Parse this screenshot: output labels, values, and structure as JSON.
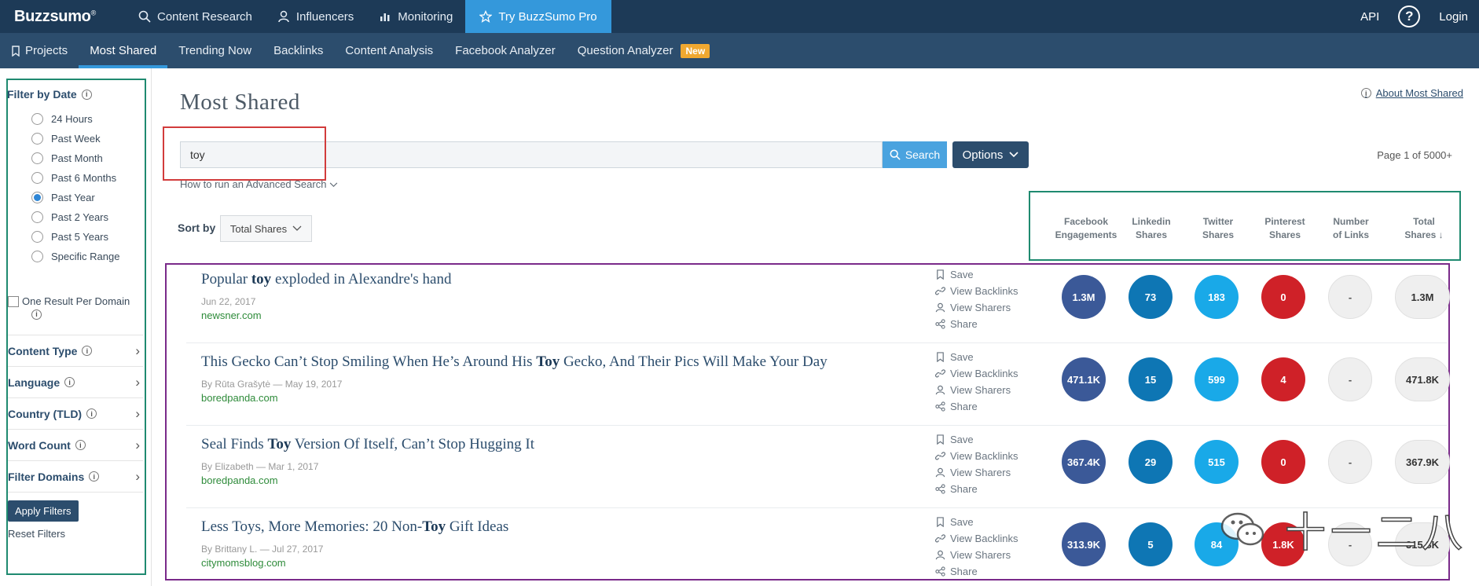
{
  "topbar": {
    "logo": "Buzzsumo",
    "nav": [
      {
        "label": "Content Research",
        "icon": "search-icon"
      },
      {
        "label": "Influencers",
        "icon": "user-icon"
      },
      {
        "label": "Monitoring",
        "icon": "bar-chart-icon"
      },
      {
        "label": "Try BuzzSumo Pro",
        "icon": "star-icon"
      }
    ],
    "api": "API",
    "help": "?",
    "login": "Login"
  },
  "subnav": {
    "items": [
      "Projects",
      "Most Shared",
      "Trending Now",
      "Backlinks",
      "Content Analysis",
      "Facebook Analyzer",
      "Question Analyzer"
    ],
    "active": "Most Shared",
    "new_badge": "New"
  },
  "sidebar": {
    "date_heading": "Filter by Date",
    "date_options": [
      "24 Hours",
      "Past Week",
      "Past Month",
      "Past 6 Months",
      "Past Year",
      "Past 2 Years",
      "Past 5 Years",
      "Specific Range"
    ],
    "selected_date": "Past Year",
    "one_result": "One Result Per Domain",
    "filters": [
      "Content Type",
      "Language",
      "Country (TLD)",
      "Word Count",
      "Filter Domains"
    ],
    "apply": "Apply Filters",
    "reset": "Reset Filters"
  },
  "main": {
    "title": "Most Shared",
    "about": "About Most Shared",
    "search_value": "toy",
    "search_button": "Search",
    "options_button": "Options",
    "page_count": "Page 1 of 5000+",
    "advanced_link": "How to run an Advanced Search",
    "sort_label": "Sort by",
    "sort_value": "Total Shares"
  },
  "columns": [
    {
      "line1": "Facebook",
      "line2": "Engagements"
    },
    {
      "line1": "Linkedin",
      "line2": "Shares"
    },
    {
      "line1": "Twitter",
      "line2": "Shares"
    },
    {
      "line1": "Pinterest",
      "line2": "Shares"
    },
    {
      "line1": "Number",
      "line2": "of Links"
    },
    {
      "line1": "Total",
      "line2": "Shares ↓"
    }
  ],
  "actions": [
    "Save",
    "View Backlinks",
    "View Sharers",
    "Share"
  ],
  "results": [
    {
      "title_pre": "Popular ",
      "title_kw": "toy",
      "title_post": " exploded in Alexandre's hand",
      "meta": "Jun 22, 2017",
      "domain": "newsner.com",
      "fb": "1.3M",
      "li": "73",
      "tw": "183",
      "pi": "0",
      "links": "-",
      "total": "1.3M"
    },
    {
      "title_pre": "This Gecko Can’t Stop Smiling When He’s Around His ",
      "title_kw": "Toy",
      "title_post": " Gecko, And Their Pics Will Make Your Day",
      "meta": "By Rūta Grašytė — May 19, 2017",
      "domain": "boredpanda.com",
      "fb": "471.1K",
      "li": "15",
      "tw": "599",
      "pi": "4",
      "links": "-",
      "total": "471.8K"
    },
    {
      "title_pre": "Seal Finds ",
      "title_kw": "Toy",
      "title_post": " Version Of Itself, Can’t Stop Hugging It",
      "meta": "By Elizabeth — Mar 1, 2017",
      "domain": "boredpanda.com",
      "fb": "367.4K",
      "li": "29",
      "tw": "515",
      "pi": "0",
      "links": "-",
      "total": "367.9K"
    },
    {
      "title_pre": "Less Toys, More Memories: 20 Non-",
      "title_kw": "Toy",
      "title_post": " Gift Ideas",
      "meta": "By Brittany L. — Jul 27, 2017",
      "domain": "citymomsblog.com",
      "fb": "313.9K",
      "li": "5",
      "tw": "84",
      "pi": "1.8K",
      "links": "-",
      "total": "315.8K"
    }
  ],
  "watermark": "十一二八"
}
